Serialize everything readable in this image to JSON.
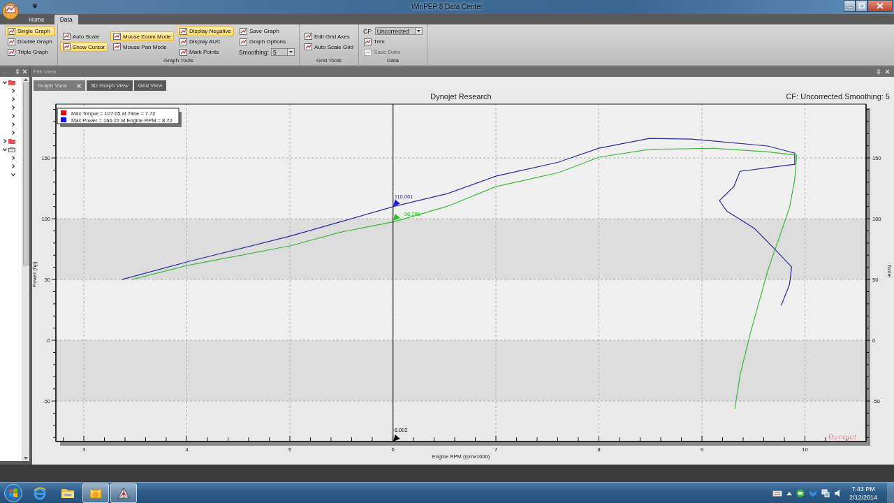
{
  "window": {
    "title": "WinPEP 8 Data Center"
  },
  "ribbon": {
    "tabs": [
      {
        "label": "Home",
        "selected": false
      },
      {
        "label": "Data",
        "selected": true
      }
    ],
    "groups": [
      {
        "columns": [
          [
            {
              "kind": "button",
              "label": "Single Graph",
              "on": true,
              "disabled": false
            },
            {
              "kind": "button",
              "label": "Double Graph",
              "on": false,
              "disabled": false
            },
            {
              "kind": "button",
              "label": "Triple Graph",
              "on": false,
              "disabled": false
            }
          ]
        ]
      },
      {
        "label": "Graph Tools",
        "columns": [
          [
            {
              "kind": "button",
              "label": "Auto Scale",
              "on": false,
              "disabled": false
            },
            {
              "kind": "button",
              "label": "Show Cursor",
              "on": true,
              "disabled": false
            }
          ],
          [
            {
              "kind": "button",
              "label": "Mouse Zoom Mode",
              "on": true,
              "disabled": false
            },
            {
              "kind": "button",
              "label": "Mouse Pan Mode",
              "on": false,
              "disabled": false
            }
          ],
          [
            {
              "kind": "button",
              "label": "Display Negative",
              "on": true,
              "disabled": false
            },
            {
              "kind": "button",
              "label": "Display AUC",
              "on": false,
              "disabled": false
            },
            {
              "kind": "button",
              "label": "Mark Points",
              "on": false,
              "disabled": false
            }
          ],
          [
            {
              "kind": "button",
              "label": "Save Graph",
              "on": false,
              "disabled": false
            },
            {
              "kind": "button",
              "label": "Graph Options",
              "on": false,
              "disabled": false
            },
            {
              "kind": "dropdown",
              "label": "Smoothing:",
              "value": "5"
            }
          ]
        ]
      },
      {
        "label": "Grid Tools",
        "columns": [
          [
            {
              "kind": "button",
              "label": "Edit Grid Axes",
              "on": false,
              "disabled": false
            },
            {
              "kind": "button",
              "label": "Auto Scale Grid",
              "on": false,
              "disabled": false
            }
          ]
        ]
      },
      {
        "label": "Data",
        "columns": [
          [
            {
              "kind": "dropdown",
              "label": "CF:",
              "value": "Uncorrected"
            },
            {
              "kind": "button",
              "label": "Trim",
              "on": false,
              "disabled": false
            },
            {
              "kind": "button",
              "label": "Save Data",
              "on": false,
              "disabled": true
            }
          ]
        ]
      }
    ]
  },
  "side_pane": {
    "title": "...",
    "tree": [
      {
        "kind": "folder",
        "expanded": true,
        "children": [
          {
            "expanded": false
          },
          {
            "expanded": false
          },
          {
            "expanded": false
          },
          {
            "expanded": false
          },
          {
            "expanded": false
          },
          {
            "expanded": false
          }
        ]
      },
      {
        "kind": "folder",
        "expanded": false
      },
      {
        "kind": "drive",
        "expanded": true,
        "children": [
          {
            "expanded": false
          },
          {
            "expanded": false
          },
          {
            "expanded": true
          }
        ]
      }
    ]
  },
  "document": {
    "title": "File View",
    "tabs": [
      {
        "label": "Graph View",
        "selected": true,
        "closable": true
      },
      {
        "label": "3D Graph View",
        "selected": false,
        "closable": false
      },
      {
        "label": "Grid View",
        "selected": false,
        "closable": false
      }
    ],
    "graph": {
      "info": "CF: Uncorrected Smoothing: 5",
      "right_axis_label": "None",
      "right_axis_ticks": [
        "150",
        "100",
        "50",
        "0",
        "-50"
      ],
      "brand": "Dynojet",
      "legend": [
        {
          "text": "Max Torque = 107.05 at Time = 7.72",
          "color": "#e01010"
        },
        {
          "text": "Max Power = 166.22 at Engine RPM = 8.72",
          "color": "#1010e0"
        }
      ],
      "chart_data": {
        "type": "line",
        "title": "Dynojet Research",
        "xlabel": "Engine RPM (rpmx1000)",
        "ylabel": "Power (hp)",
        "xlim": [
          2.729,
          10.593
        ],
        "ylim": [
          -83.3,
          194.3
        ],
        "xticks": [
          3,
          4,
          5,
          6,
          7,
          8,
          9,
          10
        ],
        "yticks": [
          -50,
          0,
          50,
          100,
          150
        ],
        "grid": true,
        "ref_lines": [
          {
            "axis": "x",
            "value": 6.002
          }
        ],
        "series": [
          {
            "color": "#2a2aa0",
            "x": [
              3.37,
              4.0,
              5.0,
              5.5,
              6.02,
              6.53,
              7.0,
              7.61,
              8.0,
              8.49,
              8.9,
              9.64,
              9.9,
              9.9,
              9.37,
              9.31,
              9.17,
              9.24,
              9.51,
              9.71,
              9.87,
              9.85,
              9.77
            ],
            "values": [
              50,
              64.4,
              85.6,
              97.7,
              110.3,
              120.7,
              135,
              146.6,
              158,
              166.1,
              165.5,
              159.8,
              154,
              144.8,
              139,
              126.4,
              115,
              106.3,
              92,
              74.7,
              60.3,
              46,
              28.7
            ]
          },
          {
            "color": "#3cb83c",
            "x": [
              3.47,
              4.0,
              5.0,
              5.5,
              6.02,
              6.53,
              7.0,
              7.61,
              8.0,
              8.49,
              9.1,
              9.64,
              9.92,
              9.9,
              9.85,
              9.64,
              9.47,
              9.37,
              9.32
            ],
            "values": [
              50,
              61.5,
              77.6,
              89,
              97.7,
              110.3,
              126.4,
              138,
              150.6,
              157,
              158,
              155,
              152.3,
              132,
              109,
              57.5,
              5.7,
              -28.7,
              -56.3
            ]
          }
        ],
        "annotations": [
          {
            "x": 6.002,
            "y": 110.061,
            "text": "110.061"
          },
          {
            "x": 6.002,
            "y": 98.256,
            "text": "98.256"
          },
          {
            "text": "6.002"
          }
        ]
      }
    }
  },
  "taskbar": {
    "apps": [
      {
        "active": false
      },
      {
        "active": false
      },
      {
        "active": true
      },
      {
        "active": true
      }
    ],
    "time": "7:43 PM",
    "date": "2/12/2014"
  }
}
